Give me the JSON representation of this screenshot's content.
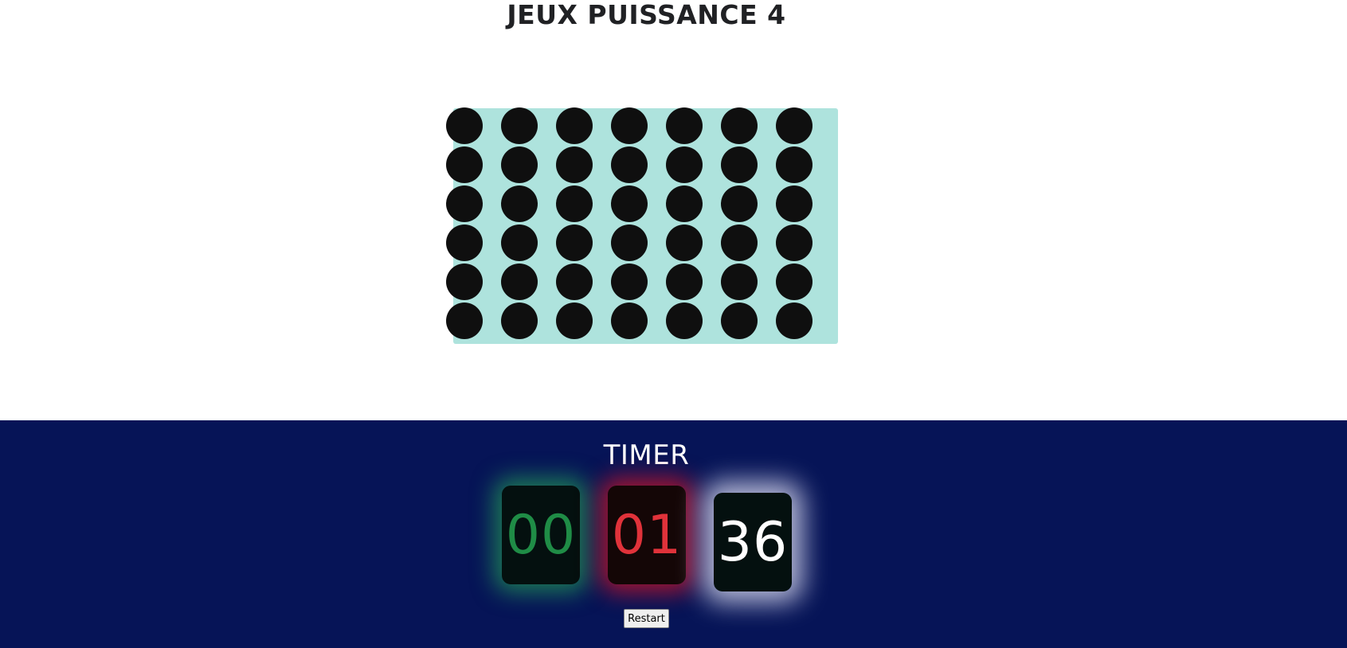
{
  "page": {
    "title": "JEUX PUISSANCE 4"
  },
  "board": {
    "rows": 6,
    "columns": 7,
    "board_color": "#aee3dd",
    "empty_cell_color": "#0f0f0f"
  },
  "timer": {
    "title": "TIMER",
    "hours": "00",
    "minutes": "01",
    "seconds": "36",
    "hours_color": "#1f8c46",
    "minutes_color": "#e0323a",
    "seconds_color": "#ffffff",
    "background_color": "#061457"
  },
  "controls": {
    "restart_label": "Restart"
  }
}
